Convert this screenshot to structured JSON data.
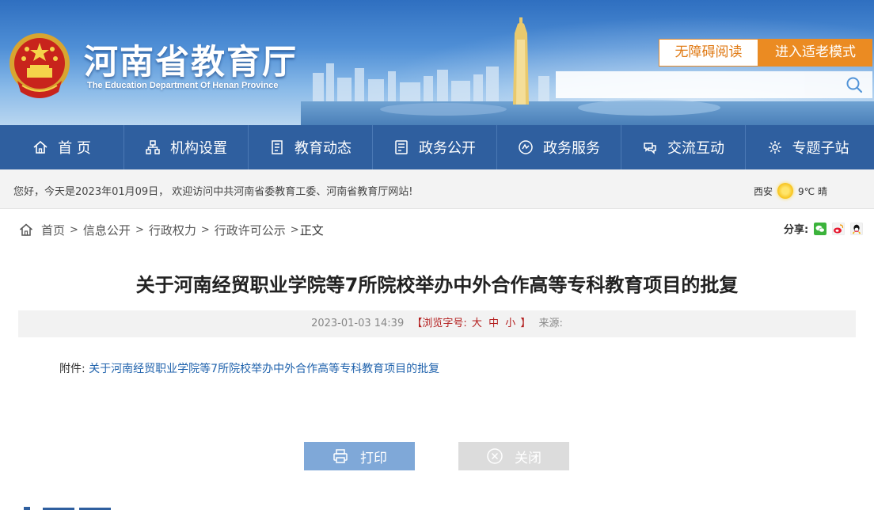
{
  "header": {
    "title": "河南省教育厅",
    "subtitle": "The Education Department Of Henan Province",
    "accessible_label": "无障碍阅读",
    "elder_mode_label": "进入适老模式",
    "search_placeholder": ""
  },
  "nav": {
    "items": [
      {
        "label": "首 页",
        "icon": "home-icon"
      },
      {
        "label": "机构设置",
        "icon": "org-icon"
      },
      {
        "label": "教育动态",
        "icon": "news-icon"
      },
      {
        "label": "政务公开",
        "icon": "publicity-icon"
      },
      {
        "label": "政务服务",
        "icon": "service-icon"
      },
      {
        "label": "交流互动",
        "icon": "interaction-icon"
      },
      {
        "label": "专题子站",
        "icon": "topic-icon"
      }
    ]
  },
  "welcome": {
    "text": "您好，今天是2023年01月09日， 欢迎访问中共河南省委教育工委、河南省教育厅网站!",
    "city": "西安",
    "weather": "9℃ 晴"
  },
  "breadcrumb": {
    "items": [
      "首页",
      "信息公开",
      "行政权力",
      "行政许可公示"
    ],
    "separator": ">",
    "current": "正文"
  },
  "share": {
    "label": "分享:",
    "icons": [
      "wechat-icon",
      "weibo-icon",
      "qq-icon"
    ]
  },
  "article": {
    "title": "关于河南经贸职业学院等7所院校举办中外合作高等专科教育项目的批复",
    "datetime": "2023-01-03 14:39",
    "font_size_label_open": "【浏览字号:",
    "font_large": "大",
    "font_medium": "中",
    "font_small": "小",
    "font_size_label_close": "】",
    "source_label": "来源:",
    "attachment_label": "附件:",
    "attachment_link": "关于河南经贸职业学院等7所院校举办中外合作高等专科教育项目的批复"
  },
  "actions": {
    "print_label": "打印",
    "close_label": "关闭"
  },
  "colors": {
    "nav_bg": "#2f5f9f",
    "accent_orange": "#eb8b22",
    "link_blue": "#1f62ac",
    "font_opts_red": "#b31d1d"
  }
}
